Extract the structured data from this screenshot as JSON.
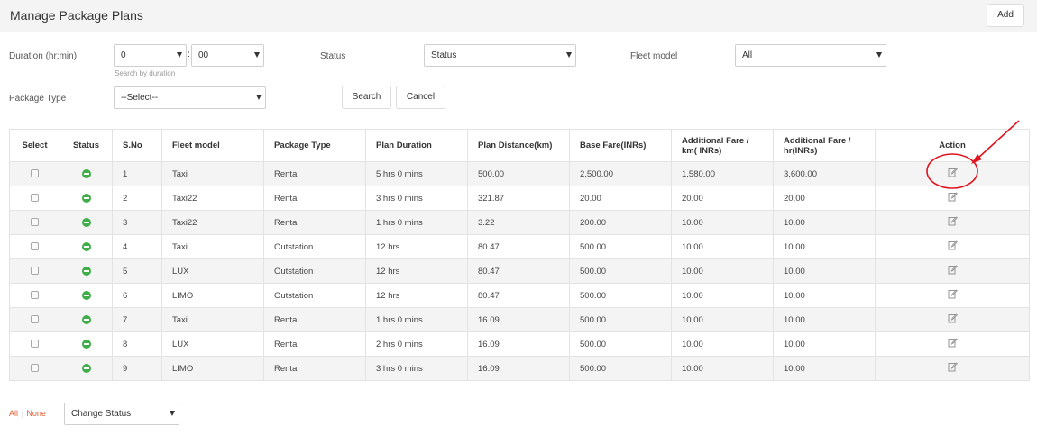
{
  "header": {
    "title": "Manage Package Plans",
    "add_label": "Add"
  },
  "filters": {
    "duration_label": "Duration (hr:min)",
    "duration_hours": "0",
    "duration_separator": ":",
    "duration_minutes": "00",
    "duration_hint": "Search by duration",
    "status_label": "Status",
    "status_value": "Status",
    "fleet_label": "Fleet model",
    "fleet_value": "All",
    "package_type_label": "Package Type",
    "package_type_value": "--Select--",
    "search_label": "Search",
    "cancel_label": "Cancel"
  },
  "table": {
    "headers": {
      "select": "Select",
      "status": "Status",
      "sno": "S.No",
      "fleet_model": "Fleet model",
      "package_type": "Package Type",
      "plan_duration": "Plan Duration",
      "plan_distance": "Plan Distance(km)",
      "base_fare": "Base Fare(INRs)",
      "add_fare_km": "Additional Fare / km( INRs)",
      "add_fare_hr": "Additional Fare / hr(INRs)",
      "action": "Action"
    },
    "rows": [
      {
        "sno": "1",
        "fleet": "Taxi",
        "type": "Rental",
        "duration": "5 hrs 0 mins",
        "distance": "500.00",
        "base": "2,500.00",
        "km": "1,580.00",
        "hr": "3,600.00"
      },
      {
        "sno": "2",
        "fleet": "Taxi22",
        "type": "Rental",
        "duration": "3 hrs 0 mins",
        "distance": "321.87",
        "base": "20.00",
        "km": "20.00",
        "hr": "20.00"
      },
      {
        "sno": "3",
        "fleet": "Taxi22",
        "type": "Rental",
        "duration": "1 hrs 0 mins",
        "distance": "3.22",
        "base": "200.00",
        "km": "10.00",
        "hr": "10.00"
      },
      {
        "sno": "4",
        "fleet": "Taxi",
        "type": "Outstation",
        "duration": "12 hrs",
        "distance": "80.47",
        "base": "500.00",
        "km": "10.00",
        "hr": "10.00"
      },
      {
        "sno": "5",
        "fleet": "LUX",
        "type": "Outstation",
        "duration": "12 hrs",
        "distance": "80.47",
        "base": "500.00",
        "km": "10.00",
        "hr": "10.00"
      },
      {
        "sno": "6",
        "fleet": "LIMO",
        "type": "Outstation",
        "duration": "12 hrs",
        "distance": "80.47",
        "base": "500.00",
        "km": "10.00",
        "hr": "10.00"
      },
      {
        "sno": "7",
        "fleet": "Taxi",
        "type": "Rental",
        "duration": "1 hrs 0 mins",
        "distance": "16.09",
        "base": "500.00",
        "km": "10.00",
        "hr": "10.00"
      },
      {
        "sno": "8",
        "fleet": "LUX",
        "type": "Rental",
        "duration": "2 hrs 0 mins",
        "distance": "16.09",
        "base": "500.00",
        "km": "10.00",
        "hr": "10.00"
      },
      {
        "sno": "9",
        "fleet": "LIMO",
        "type": "Rental",
        "duration": "3 hrs 0 mins",
        "distance": "16.09",
        "base": "500.00",
        "km": "10.00",
        "hr": "10.00"
      }
    ]
  },
  "footer": {
    "all_label": "All",
    "separator": "|",
    "none_label": "None",
    "change_status_value": "Change Status"
  },
  "icons": {
    "status": "status-active-icon",
    "action": "edit-icon"
  },
  "colors": {
    "status_active": "#3fae49",
    "link": "#e55b2d",
    "annotation": "#e0141e",
    "header_bg": "#f4f4f4"
  }
}
